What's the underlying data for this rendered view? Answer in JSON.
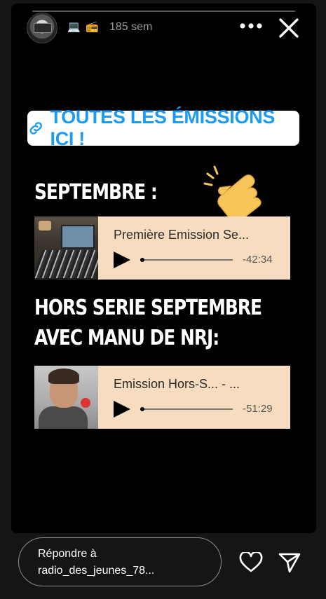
{
  "header": {
    "timestamp": "185 sem",
    "emoji_1": "💻",
    "emoji_2": "📻",
    "icons": [
      "avatar",
      "more-icon",
      "close-icon"
    ]
  },
  "story": {
    "link_sticker": "TOUTES LES ÉMISSIONS ICI !",
    "heading_1": "SEPTEMBRE :",
    "heading_2_line_1": "HORS SERIE SEPTEMBRE",
    "heading_2_line_2": "AVEC MANU DE NRJ:",
    "players": [
      {
        "title": "Première Emission Se...",
        "time": "-42:34",
        "progress": 0.02
      },
      {
        "title": "Emission Hors-S...   - ...",
        "time": "-51:29",
        "progress": 0.02
      }
    ]
  },
  "footer": {
    "reply_line_1": "Répondre à",
    "reply_line_2": "radio_des_jeunes_78..."
  },
  "colors": {
    "link_blue": "#1d9bf0",
    "player_bg": "#f8dcc0",
    "background": "#000000"
  }
}
